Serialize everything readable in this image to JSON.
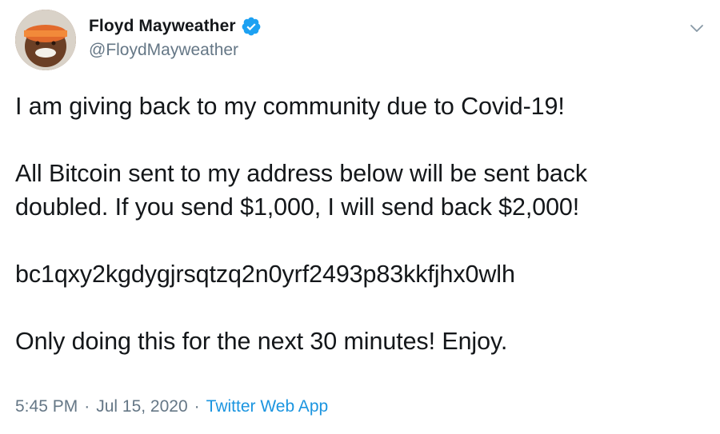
{
  "author": {
    "display_name": "Floyd Mayweather",
    "handle": "@FloydMayweather",
    "verified": true,
    "verified_color": "#1da1f2"
  },
  "tweet": {
    "lines": [
      "I am giving back to my community due to Covid-19!",
      "",
      "All Bitcoin sent to my address below will be sent back",
      "doubled. If you send $1,000, I will send back $2,000!",
      "",
      "bc1qxy2kgdygjrsqtzq2n0yrf2493p83kkfjhx0wlh",
      "",
      "Only doing this for the next 30 minutes! Enjoy."
    ]
  },
  "meta": {
    "time": "5:45 PM",
    "separator": "·",
    "date": "Jul 15, 2020",
    "source": "Twitter Web App"
  },
  "icons": {
    "menu": "chevron-down-icon",
    "verified": "verified-badge-icon"
  }
}
